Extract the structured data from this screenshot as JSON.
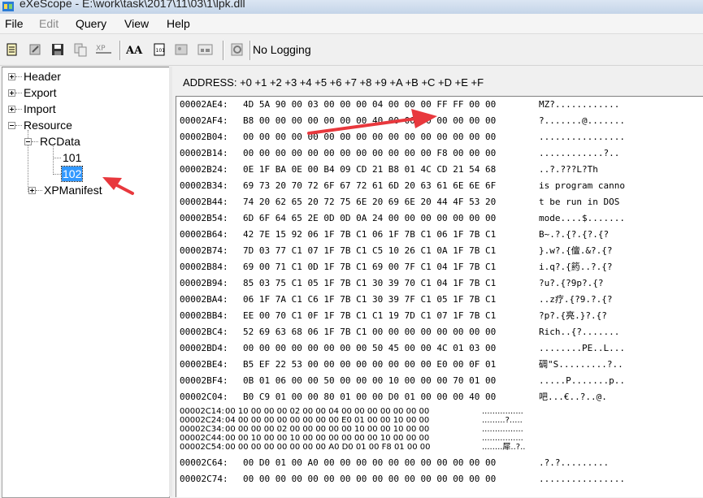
{
  "window": {
    "title": "eXeScope - E:\\work\\task\\2017\\11\\03\\1\\lpk.dll"
  },
  "menu": [
    "File",
    "Edit",
    "Query",
    "View",
    "Help"
  ],
  "toolbar": {
    "logging_label": "No Logging"
  },
  "tree": {
    "header": "Header",
    "export": "Export",
    "import": "Import",
    "resource": "Resource",
    "rcdata": "RCData",
    "item101": "101",
    "item102": "102",
    "xpmanifest": "XPManifest"
  },
  "hex": {
    "header": "ADDRESS:  +0 +1 +2 +3 +4 +5 +6 +7 +8 +9 +A +B +C +D +E +F",
    "rows": [
      {
        "addr": "00002AE4:",
        "bytes": "4D 5A 90 00 03 00 00 00 04 00 00 00 FF FF 00 00",
        "ascii": "MZ?............"
      },
      {
        "addr": "00002AF4:",
        "bytes": "B8 00 00 00 00 00 00 00 40 00 00 00 00 00 00 00",
        "ascii": "?.......@......."
      },
      {
        "addr": "00002B04:",
        "bytes": "00 00 00 00 00 00 00 00 00 00 00 00 00 00 00 00",
        "ascii": "................"
      },
      {
        "addr": "00002B14:",
        "bytes": "00 00 00 00 00 00 00 00 00 00 00 00 F8 00 00 00",
        "ascii": "............?.."
      },
      {
        "addr": "00002B24:",
        "bytes": "0E 1F BA 0E 00 B4 09 CD 21 B8 01 4C CD 21 54 68",
        "ascii": "..?.???L?Th"
      },
      {
        "addr": "00002B34:",
        "bytes": "69 73 20 70 72 6F 67 72 61 6D 20 63 61 6E 6E 6F",
        "ascii": "is program canno"
      },
      {
        "addr": "00002B44:",
        "bytes": "74 20 62 65 20 72 75 6E 20 69 6E 20 44 4F 53 20",
        "ascii": "t be run in DOS"
      },
      {
        "addr": "00002B54:",
        "bytes": "6D 6F 64 65 2E 0D 0D 0A 24 00 00 00 00 00 00 00",
        "ascii": "mode....$......."
      },
      {
        "addr": "00002B64:",
        "bytes": "42 7E 15 92 06 1F 7B C1 06 1F 7B C1 06 1F 7B C1",
        "ascii": "B~.?.{?.{?.{?"
      },
      {
        "addr": "00002B74:",
        "bytes": "7D 03 77 C1 07 1F 7B C1 C5 10 26 C1 0A 1F 7B C1",
        "ascii": "}.w?.{儃.&?.{?"
      },
      {
        "addr": "00002B84:",
        "bytes": "69 00 71 C1 0D 1F 7B C1 69 00 7F C1 04 1F 7B C1",
        "ascii": "i.q?.{箹..?.{?"
      },
      {
        "addr": "00002B94:",
        "bytes": "85 03 75 C1 05 1F 7B C1 30 39 70 C1 04 1F 7B C1",
        "ascii": "?u?.{?9p?.{?"
      },
      {
        "addr": "00002BA4:",
        "bytes": "06 1F 7A C1 C6 1F 7B C1 30 39 7F C1 05 1F 7B C1",
        "ascii": "..z疗.{?9.?.{?"
      },
      {
        "addr": "00002BB4:",
        "bytes": "EE 00 70 C1 0F 1F 7B C1 C1 19 7D C1 07 1F 7B C1",
        "ascii": "?p?.{亮.}?.{?"
      },
      {
        "addr": "00002BC4:",
        "bytes": "52 69 63 68 06 1F 7B C1 00 00 00 00 00 00 00 00",
        "ascii": "Rich..{?......."
      },
      {
        "addr": "00002BD4:",
        "bytes": "00 00 00 00 00 00 00 00 50 45 00 00 4C 01 03 00",
        "ascii": "........PE..L..."
      },
      {
        "addr": "00002BE4:",
        "bytes": "B5 EF 22 53 00 00 00 00 00 00 00 00 E0 00 0F 01",
        "ascii": "碉\"S.........?.."
      },
      {
        "addr": "00002BF4:",
        "bytes": "0B 01 06 00 00 50 00 00 00 10 00 00 00 70 01 00",
        "ascii": ".....P.......p.."
      },
      {
        "addr": "00002C04:",
        "bytes": "B0 C9 01 00 00 80 01 00 00 D0 01 00 00 00 40 00",
        "ascii": "吧...€..?..@."
      }
    ],
    "small_rows": [
      {
        "addr": "00002C14:",
        "bytes": "00 10 00 00 00 02 00 00 04 00 00 00 00 00 00 00",
        "ascii": "................"
      },
      {
        "addr": "00002C24:",
        "bytes": "04 00 00 00 00 00 00 00 00 E0 01 00 00 10 00 00",
        "ascii": ".........?....."
      },
      {
        "addr": "00002C34:",
        "bytes": "00 00 00 00 02 00 00 00 00 00 10 00 00 10 00 00",
        "ascii": "................"
      },
      {
        "addr": "00002C44:",
        "bytes": "00 00 10 00 00 10 00 00 00 00 00 00 10 00 00 00",
        "ascii": "................"
      },
      {
        "addr": "00002C54:",
        "bytes": "00 00 00 00 00 00 00 00 A0 D0 01 00 F8 01 00 00",
        "ascii": "........犀..?.."
      }
    ],
    "tail_rows": [
      {
        "addr": "00002C64:",
        "bytes": "00 D0 01 00 A0 00 00 00 00 00 00 00 00 00 00 00",
        "ascii": ".?.?........."
      },
      {
        "addr": "00002C74:",
        "bytes": "00 00 00 00 00 00 00 00 00 00 00 00 00 00 00 00",
        "ascii": "................"
      }
    ]
  },
  "colors": {
    "annotation_arrow": "#e8383d",
    "selection": "#3399ff"
  }
}
